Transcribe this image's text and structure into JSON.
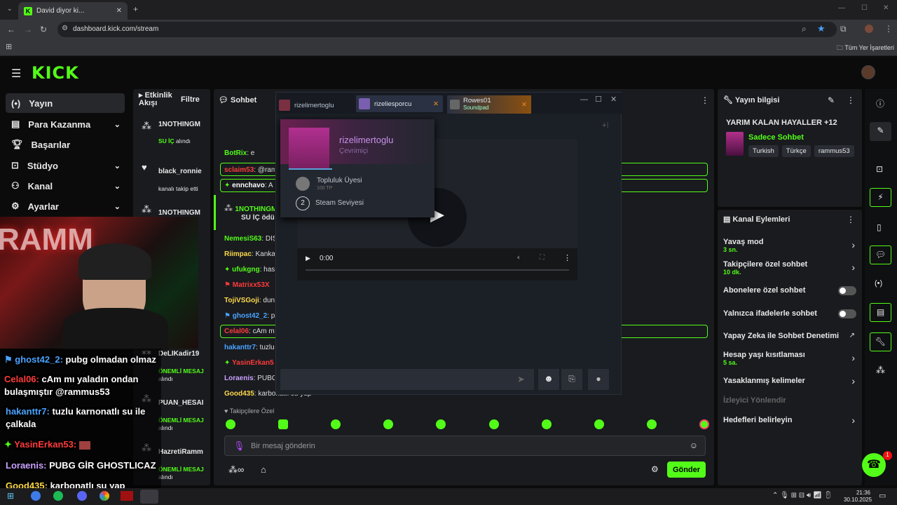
{
  "browser": {
    "tab_title": "David diyor ki...",
    "url": "dashboard.kick.com/stream",
    "bookmarks_label": "Tüm Yer İşaretleri"
  },
  "logo": "KICK",
  "nav": [
    {
      "label": "Yayın"
    },
    {
      "label": "Para Kazanma"
    },
    {
      "label": "Başarılar"
    },
    {
      "label": "Stüdyo"
    },
    {
      "label": "Kanal"
    },
    {
      "label": "Ayarlar"
    }
  ],
  "activity": {
    "title": "Etkinlik Akışı",
    "filter": "Filtre",
    "items": [
      {
        "user": "1NOTHINGM",
        "sub": "SU İÇ",
        "sub2": "alındı"
      },
      {
        "user": "black_ronnie",
        "sub": "kanalı takip etti"
      },
      {
        "user": "1NOTHINGM",
        "sub": ""
      },
      {
        "user": "DeLIKadir19",
        "sub": "ÖNEMLİ MESAJ",
        "sub2": "alındı"
      },
      {
        "user": "PUAN_HESAI",
        "sub": "ÖNEMLİ MESAJ",
        "sub2": "alındı"
      },
      {
        "user": "HazretiRamm",
        "sub": "ÖNEMLİ MESAJ",
        "sub2": "alındı"
      }
    ]
  },
  "chat": {
    "title": "Sohbet",
    "followers_only": "Takipçilere Özel",
    "placeholder": "Bir mesaj gönderin",
    "send": "Gönder",
    "lines": [
      {
        "user": "BotRix",
        "text": ": e",
        "color": "#53fc18"
      },
      {
        "user": "sclaim53",
        "text": ": @ram",
        "color": "#ff3b3b"
      },
      {
        "user": "ennchavo",
        "text": ": A",
        "color": "#53fc18"
      },
      {
        "user": "1NOTHINGM",
        "text": "SU İÇ ödülü",
        "color": "#53fc18"
      },
      {
        "user": "NemesiS63",
        "text": ": DİŞ",
        "color": "#53fc18"
      },
      {
        "user": "Riimpac",
        "text": ": Kanka",
        "color": "#ffd94a"
      },
      {
        "user": "ufukgng",
        "text": ": has",
        "color": "#53fc18"
      },
      {
        "user": "Matrixx53X",
        "text": "",
        "color": "#ff3b3b"
      },
      {
        "user": "TojiVSGoji",
        "text": ": dun",
        "color": "#ffd94a"
      },
      {
        "user": "ghost42_2",
        "text": ": p",
        "color": "#4aa3ff"
      },
      {
        "user": "Celal06",
        "text": ": cAm m",
        "color": "#ff3b3b"
      },
      {
        "user": "hakanttr7",
        "text": ": tuzlu",
        "color": "#4aa3ff"
      },
      {
        "user": "YasinErkan5",
        "text": "",
        "color": "#ff3b3b"
      },
      {
        "user": "Loraenis",
        "text": ": PUBG",
        "color": "#c9a0ff"
      },
      {
        "user": "Good435",
        "text": ": karbonatlı su yap",
        "color": "#ffd94a"
      }
    ]
  },
  "steam": {
    "tabs": [
      {
        "name": "rizelimertoglu",
        "sub": ""
      },
      {
        "name": "rizeliesporcu",
        "sub": ""
      },
      {
        "name": "Rowes01",
        "sub": "Soundpad"
      }
    ],
    "profile_name": "rizelimertoglu",
    "profile_status": "Çevrimiçi",
    "badge1": "Topluluk Üyesi",
    "badge1_sub": "100 TP",
    "level": "2",
    "badge2": "Steam Seviyesi",
    "time": "0:00"
  },
  "stream_info": {
    "title": "Yayın bilgisi",
    "stream_title": "YARIM KALAN HAYALLER +12",
    "category": "Sadece Sohbet",
    "tags": [
      "Turkish",
      "Türkçe",
      "rammus53"
    ]
  },
  "actions": {
    "title": "Kanal Eylemleri",
    "items": [
      {
        "label": "Yavaş mod",
        "sub": "3 sn."
      },
      {
        "label": "Takipçilere özel sohbet",
        "sub": "10 dk."
      },
      {
        "label": "Abonelere özel sohbet",
        "sub": ""
      },
      {
        "label": "Yalnızca ifadelerle sohbet",
        "sub": ""
      },
      {
        "label": "Yapay Zeka ile Sohbet Denetimi",
        "sub": ""
      },
      {
        "label": "Hesap yaşı kısıtlaması",
        "sub": "5 sa."
      },
      {
        "label": "Yasaklanmış kelimeler",
        "sub": ""
      },
      {
        "label": "İzleyici Yönlendir",
        "sub": ""
      },
      {
        "label": "Hedefleri belirleyin",
        "sub": ""
      }
    ]
  },
  "overlay": [
    {
      "user": "ghost42_2:",
      "text": " pubg olmadan olmaz",
      "color": "#4aa3ff"
    },
    {
      "user": "Celal06:",
      "text": " cAm mı yaladın ondan",
      "color": "#ff3b3b"
    },
    {
      "user": "",
      "text": "bulaşmıştır @rammus53",
      "color": "#fff"
    },
    {
      "user": "hakanttr7:",
      "text": " tuzlu karnonatlı su ile",
      "color": "#4aa3ff"
    },
    {
      "user": "",
      "text": "çalkala",
      "color": "#fff"
    },
    {
      "user": "YasinErkan53:",
      "text": "",
      "color": "#ff3b3b"
    },
    {
      "user": "Loraenis:",
      "text": " PUBG GİR GHOSTLICAZ",
      "color": "#c9a0ff"
    },
    {
      "user": "Good435:",
      "text": " karbonatlı su yap",
      "color": "#ffd94a"
    }
  ],
  "cam_text": "RAMM",
  "taskbar": {
    "time": "21:36",
    "date": "30.10.2025",
    "notif": "1"
  },
  "colors": {
    "accent": "#53fc18"
  }
}
